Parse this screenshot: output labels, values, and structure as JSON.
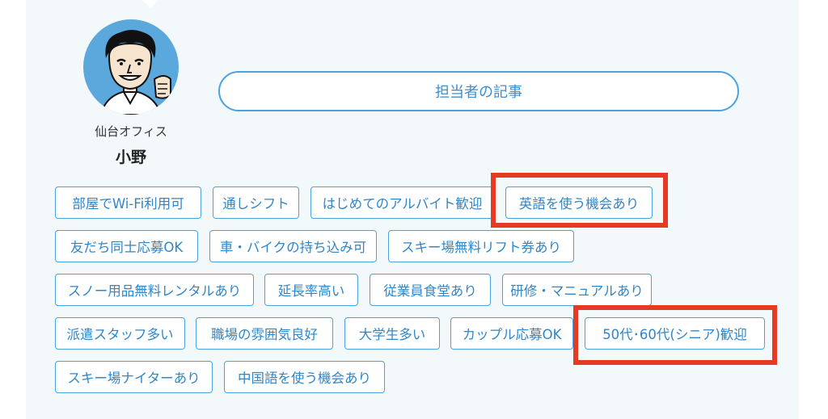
{
  "profile": {
    "office": "仙台オフィス",
    "name": "小野",
    "articles_button": "担当者の記事"
  },
  "tags": [
    "部屋でWi-Fi利用可",
    "通しシフト",
    "はじめてのアルバイト歓迎",
    "英語を使う機会あり",
    "友だち同士応募OK",
    "車・バイクの持ち込み可",
    "スキー場無料リフト券あり",
    "スノー用品無料レンタルあり",
    "延長率高い",
    "従業員食堂あり",
    "研修・マニュアルあり",
    "派遣スタッフ多い",
    "職場の雰囲気良好",
    "大学生多い",
    "カップル応募OK",
    "50代･60代(シニア)歓迎",
    "スキー場ナイターあり",
    "中国語を使う機会あり"
  ],
  "highlighted_tags": [
    "英語を使う機会あり",
    "50代･60代(シニア)歓迎"
  ],
  "colors": {
    "accent": "#4aa3df",
    "tag_text": "#2f86c8",
    "highlight": "#e53a24",
    "panel_bg": "#f3f8fb"
  }
}
